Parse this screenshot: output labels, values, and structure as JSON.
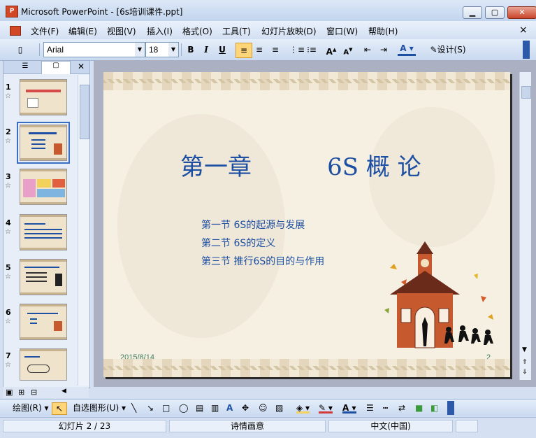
{
  "window": {
    "title": "Microsoft PowerPoint - [6s培训课件.ppt]",
    "app_icon_text": "P"
  },
  "menu": {
    "items": [
      "文件(F)",
      "编辑(E)",
      "视图(V)",
      "插入(I)",
      "格式(O)",
      "工具(T)",
      "幻灯片放映(D)",
      "窗口(W)",
      "帮助(H)"
    ],
    "close": "×"
  },
  "toolbar": {
    "font_name": "Arial",
    "font_size": "18",
    "bold": "B",
    "italic": "I",
    "underline": "U",
    "design_label": "设计(S)"
  },
  "thumbnails": {
    "numbers": [
      "1",
      "2",
      "3",
      "4",
      "5",
      "6",
      "7"
    ],
    "selected": "2",
    "star_icon": "☆"
  },
  "slide": {
    "title": "第一章          6S 概 论",
    "sections": [
      "第一节   6S的起源与发展",
      "第二节   6S的定义",
      "第三节   推行6S的目的与作用"
    ],
    "date": "2015/8/14",
    "page_number": "2"
  },
  "drawing_toolbar": {
    "draw_label": "绘图(R)",
    "autoshapes_label": "自选图形(U)"
  },
  "status": {
    "slide_info": "幻灯片 2 / 23",
    "design": "诗情画意",
    "language": "中文(中国)"
  },
  "colors": {
    "accent": "#1d4fa3",
    "slide_bg": "#f6f0e2",
    "building": "#c65a2e"
  }
}
